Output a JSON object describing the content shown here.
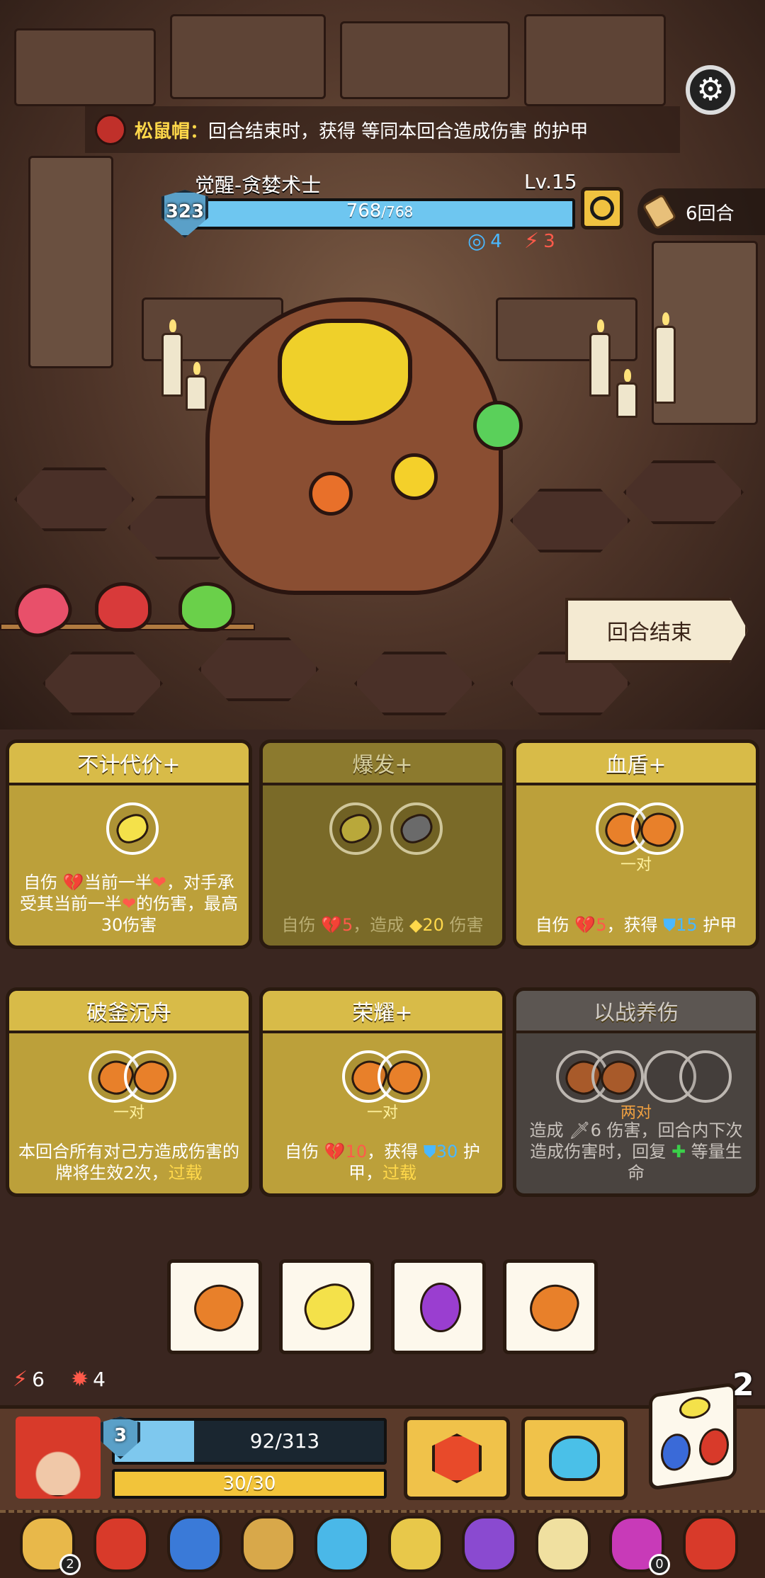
{
  "notice": {
    "relic_name": "松鼠帽",
    "colon": "：",
    "effect_text": "回合结束时，获得 等同本回合造成伤害 的护甲"
  },
  "enemy": {
    "name": "觉醒-贪婪术士",
    "level": "Lv.15",
    "armor": "323",
    "hp_current": "768",
    "hp_max": "/768",
    "hp_fraction": 1.0,
    "status": [
      {
        "icon": "swirl-icon",
        "value": "4",
        "color": "#4ab8ff"
      },
      {
        "icon": "broken-heart-icon",
        "value": "3",
        "color": "#ff5a4a"
      }
    ]
  },
  "turn": {
    "label": "6回合"
  },
  "end_turn_button": "回合结束",
  "potions": [
    {
      "icon": "pink-potion-icon",
      "color": "#e8506a"
    },
    {
      "icon": "red-potion-icon",
      "color": "#d83a3a"
    },
    {
      "icon": "green-potion-icon",
      "color": "#6ad04a"
    }
  ],
  "cards": [
    {
      "title": "不计代价+",
      "state": "active",
      "slots": [
        "lemon"
      ],
      "pair_label": "",
      "desc": [
        [
          {
            "t": "自伤 "
          },
          {
            "t": "💔",
            "c": "red"
          },
          {
            "t": "当前一半"
          },
          {
            "t": "❤",
            "c": "red"
          },
          {
            "t": "，对手承受其当前一半"
          },
          {
            "t": "❤",
            "c": "red"
          },
          {
            "t": "的伤害，最高30伤害"
          }
        ]
      ]
    },
    {
      "title": "爆发+",
      "state": "faded",
      "slots": [
        "lemon",
        "dark-lemon"
      ],
      "pair_label": "",
      "desc": [
        [
          {
            "t": "自伤 "
          },
          {
            "t": "💔5",
            "c": "red"
          },
          {
            "t": "，造成 "
          },
          {
            "t": "◆20",
            "c": "gold"
          },
          {
            "t": " 伤害"
          }
        ]
      ]
    },
    {
      "title": "血盾+",
      "state": "active",
      "slots": [
        "mango-pair"
      ],
      "pair_label": "一对",
      "desc": [
        [
          {
            "t": "自伤 "
          },
          {
            "t": "💔5",
            "c": "red"
          },
          {
            "t": "，获得 "
          },
          {
            "t": "⛊15",
            "c": "blue"
          },
          {
            "t": " 护甲"
          }
        ]
      ]
    },
    {
      "title": "破釜沉舟",
      "state": "active",
      "slots": [
        "mango-pair"
      ],
      "pair_label": "一对",
      "desc": [
        [
          {
            "t": "本回合所有对己方造成伤害的牌将生效2次，"
          },
          {
            "t": "过载",
            "c": "gold"
          }
        ]
      ]
    },
    {
      "title": "荣耀+",
      "state": "active",
      "slots": [
        "mango-pair"
      ],
      "pair_label": "一对",
      "desc": [
        [
          {
            "t": "自伤 "
          },
          {
            "t": "💔10",
            "c": "red"
          },
          {
            "t": "，获得 "
          },
          {
            "t": "⛊30",
            "c": "blue"
          },
          {
            "t": " 护甲，"
          },
          {
            "t": "过载",
            "c": "gold"
          }
        ]
      ]
    },
    {
      "title": "以战养伤",
      "state": "gray",
      "slots": [
        "mango-pair",
        "empty-pair"
      ],
      "pair_label": "两对",
      "desc": [
        [
          {
            "t": "造成 "
          },
          {
            "t": "🗡6",
            "c": ""
          },
          {
            "t": " 伤害，回合内下次造成伤害时，回复 "
          },
          {
            "t": "✚",
            "c": "green"
          },
          {
            "t": " 等量生命"
          }
        ]
      ]
    }
  ],
  "dice": [
    "mango",
    "lemon",
    "grape",
    "mango"
  ],
  "player": {
    "status": [
      {
        "icon": "broken-heart-icon",
        "value": "6",
        "color": "#ff5a4a"
      },
      {
        "icon": "gear-burst-icon",
        "value": "4",
        "color": "#ff5a4a"
      }
    ],
    "armor": "3",
    "hp": "92/313",
    "hp_fraction": 0.294,
    "energy": "30/30",
    "energy_fraction": 1.0,
    "reroll_count": "2"
  },
  "relics": [
    {
      "icon": "money-bag-icon",
      "badge": "2",
      "color": "#e8b84a"
    },
    {
      "icon": "red-dragon-icon",
      "badge": "",
      "color": "#d83a2a"
    },
    {
      "icon": "spiked-orb-icon",
      "badge": "",
      "color": "#3a7ad8"
    },
    {
      "icon": "lion-badge-icon",
      "badge": "",
      "color": "#d8a84a"
    },
    {
      "icon": "blue-shield-icon",
      "badge": "",
      "color": "#4ab8e8"
    },
    {
      "icon": "gold-star-icon",
      "badge": "",
      "color": "#e8c84a"
    },
    {
      "icon": "purple-hat-icon",
      "badge": "",
      "color": "#8a4ad0"
    },
    {
      "icon": "gear-medal-icon",
      "badge": "",
      "color": "#f0e0a0"
    },
    {
      "icon": "yin-yang-icon",
      "badge": "0",
      "color": "#c83ab8"
    },
    {
      "icon": "red-helmet-icon",
      "badge": "",
      "color": "#d83a2a"
    }
  ]
}
